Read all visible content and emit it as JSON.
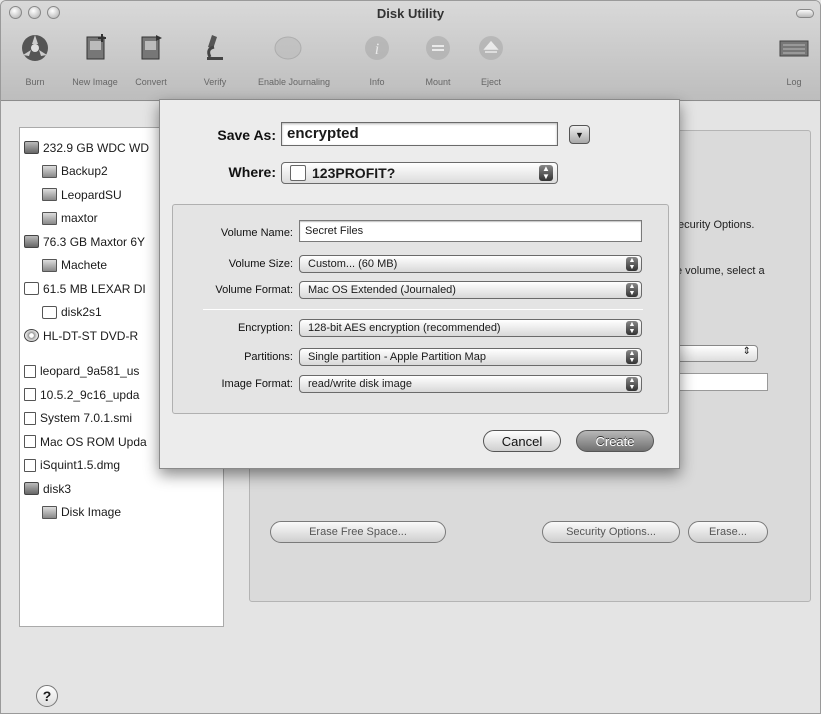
{
  "window": {
    "title": "Disk Utility"
  },
  "toolbar": [
    {
      "label": "Burn",
      "icon": "burn-icon"
    },
    {
      "label": "New Image",
      "icon": "new-image-icon"
    },
    {
      "label": "Convert",
      "icon": "convert-icon"
    },
    {
      "label": "Verify",
      "icon": "verify-icon"
    },
    {
      "label": "Enable Journaling",
      "icon": "journal-icon"
    },
    {
      "label": "Info",
      "icon": "info-icon"
    },
    {
      "label": "Mount",
      "icon": "mount-icon"
    },
    {
      "label": "Eject",
      "icon": "eject-icon"
    },
    {
      "label": "Log",
      "icon": "log-icon"
    }
  ],
  "sidebar": {
    "items": [
      {
        "label": "232.9 GB WDC WD",
        "icon": "hard-drive-icon"
      },
      {
        "label": "Backup2",
        "icon": "volume-icon"
      },
      {
        "label": "LeopardSU",
        "icon": "volume-icon"
      },
      {
        "label": "maxtor",
        "icon": "volume-icon"
      },
      {
        "label": "76.3 GB Maxtor 6Y",
        "icon": "hard-drive-icon"
      },
      {
        "label": "Machete",
        "icon": "volume-icon"
      },
      {
        "label": "61.5 MB LEXAR DI",
        "icon": "usb-drive-icon"
      },
      {
        "label": "disk2s1",
        "icon": "partition-icon"
      },
      {
        "label": "HL-DT-ST DVD-R",
        "icon": "optical-drive-icon"
      },
      {
        "label": "leopard_9a581_us",
        "icon": "disk-image-icon"
      },
      {
        "label": "10.5.2_9c16_upda",
        "icon": "disk-image-icon"
      },
      {
        "label": "System 7.0.1.smi",
        "icon": "disk-image-icon"
      },
      {
        "label": "Mac OS ROM Upda",
        "icon": "disk-image-icon"
      },
      {
        "label": "iSquint1.5.dmg",
        "icon": "disk-image-icon"
      },
      {
        "label": "disk3",
        "icon": "hard-drive-icon"
      },
      {
        "label": "Disk Image",
        "icon": "volume-icon"
      }
    ]
  },
  "rightpane": {
    "security_text": "ecurity Options.",
    "volume_text": "e volume, select a",
    "erase_free_space": "Erase Free Space...",
    "security_options": "Security Options...",
    "erase": "Erase..."
  },
  "dialog": {
    "save_as_label": "Save As:",
    "save_as_value": "encrypted",
    "where_label": "Where:",
    "where_value": "123PROFIT?",
    "fields": {
      "volume_name_label": "Volume Name:",
      "volume_name_value": "Secret Files",
      "volume_size_label": "Volume Size:",
      "volume_size_value": "Custom... (60 MB)",
      "volume_format_label": "Volume Format:",
      "volume_format_value": "Mac OS Extended (Journaled)",
      "encryption_label": "Encryption:",
      "encryption_value": "128-bit AES encryption (recommended)",
      "partitions_label": "Partitions:",
      "partitions_value": "Single partition - Apple Partition Map",
      "image_format_label": "Image Format:",
      "image_format_value": "read/write disk image"
    },
    "cancel": "Cancel",
    "create": "Create"
  },
  "help": "?"
}
